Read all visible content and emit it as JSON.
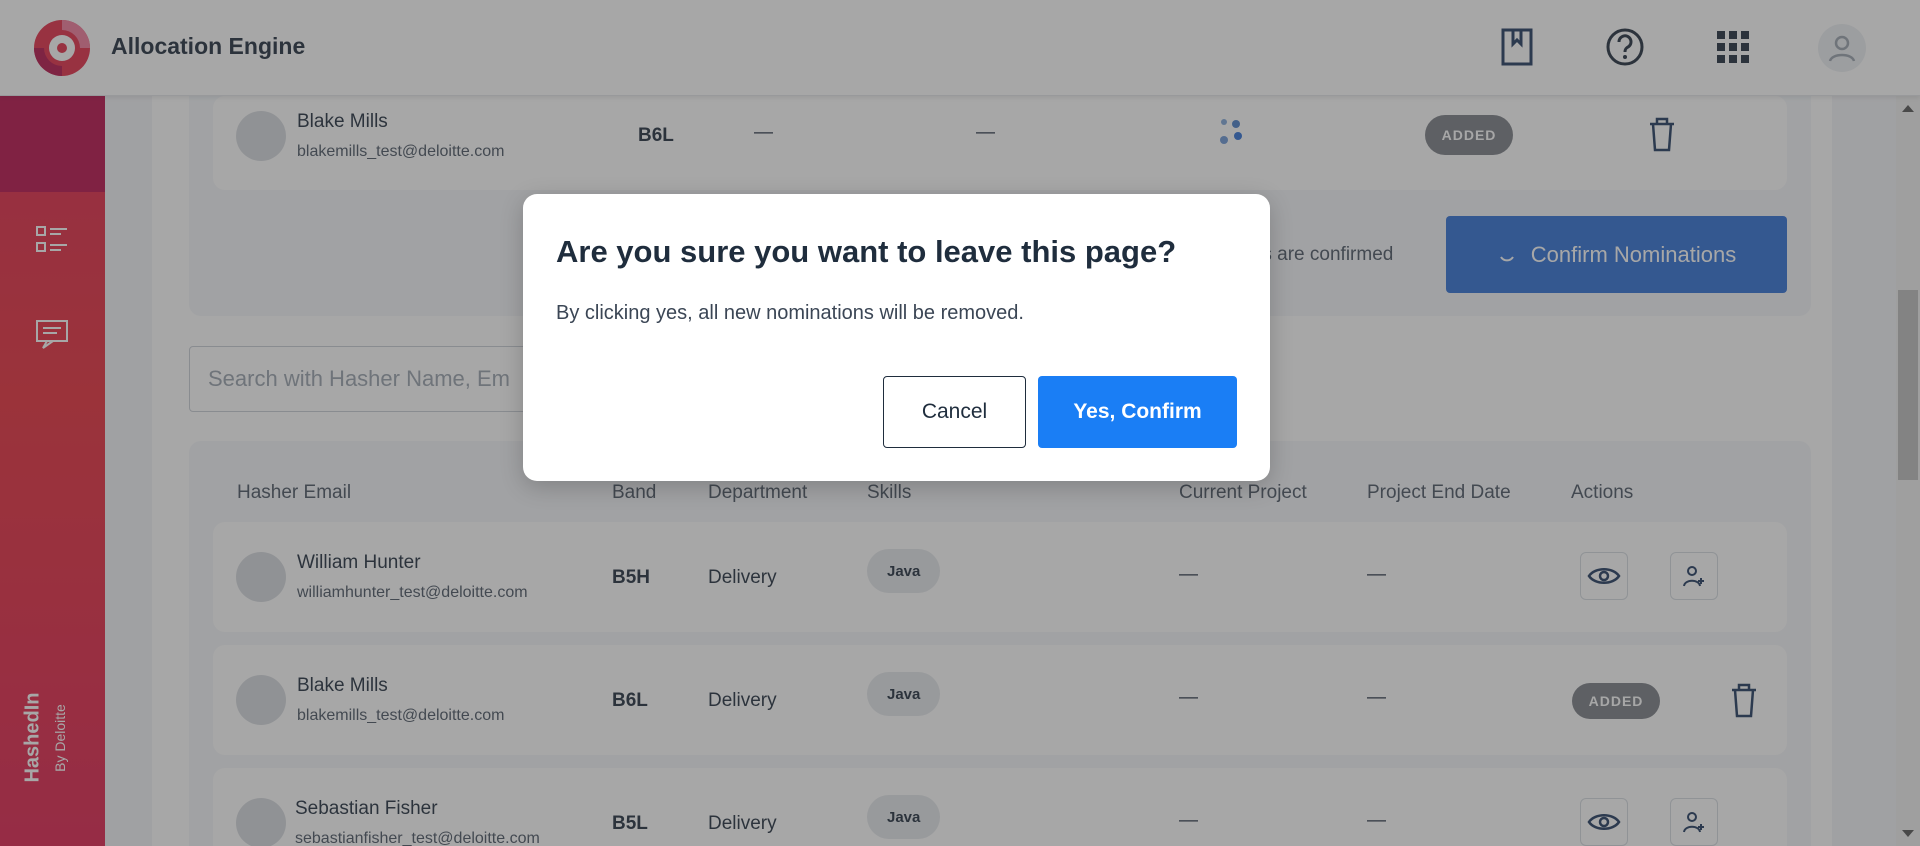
{
  "header": {
    "app_title": "Allocation Engine",
    "icons": [
      "bookmark-icon",
      "help-icon",
      "apps-grid-icon",
      "user-avatar-icon"
    ]
  },
  "sidebar": {
    "icons": [
      "list-icon",
      "message-icon"
    ],
    "brand_main": "HashedIn",
    "brand_sub": "By Deloitte"
  },
  "nominee": {
    "name": "Blake Mills",
    "email": "blakemills_test@deloitte.com",
    "band": "B6L",
    "project": "—",
    "end_date": "—",
    "status": "ADDED",
    "confirm_note": "Nominations are confirmed",
    "confirm_note_visible": "ominations are confirmed",
    "confirm_button": "Confirm Nominations"
  },
  "search": {
    "placeholder": "Search with Hasher Name, Email",
    "visible_text": "Search with Hasher Name, Em",
    "filter_count": "!"
  },
  "table": {
    "headers": [
      "Hasher Email",
      "Band",
      "Department",
      "Skills",
      "Current Project",
      "Project End Date",
      "Actions"
    ],
    "rows": [
      {
        "name": "William Hunter",
        "email": "williamhunter_test@deloitte.com",
        "band": "B5H",
        "department": "Delivery",
        "skill": "Java",
        "project": "—",
        "end_date": "—",
        "status": ""
      },
      {
        "name": "Blake Mills",
        "email": "blakemills_test@deloitte.com",
        "band": "B6L",
        "department": "Delivery",
        "skill": "Java",
        "project": "—",
        "end_date": "—",
        "status": "ADDED"
      },
      {
        "name": "Sebastian Fisher",
        "email": "sebastianfisher_test@deloitte.com",
        "band": "B5L",
        "department": "Delivery",
        "skill": "Java",
        "project": "—",
        "end_date": "—",
        "status": ""
      }
    ]
  },
  "modal": {
    "title": "Are you sure you want to leave this page?",
    "body": "By clicking yes, all new nominations will be removed.",
    "cancel_label": "Cancel",
    "confirm_label": "Yes, Confirm"
  },
  "colors": {
    "primary": "#1a7ef5",
    "sidebar": "#e0244a",
    "badge": "#7b7f86"
  }
}
